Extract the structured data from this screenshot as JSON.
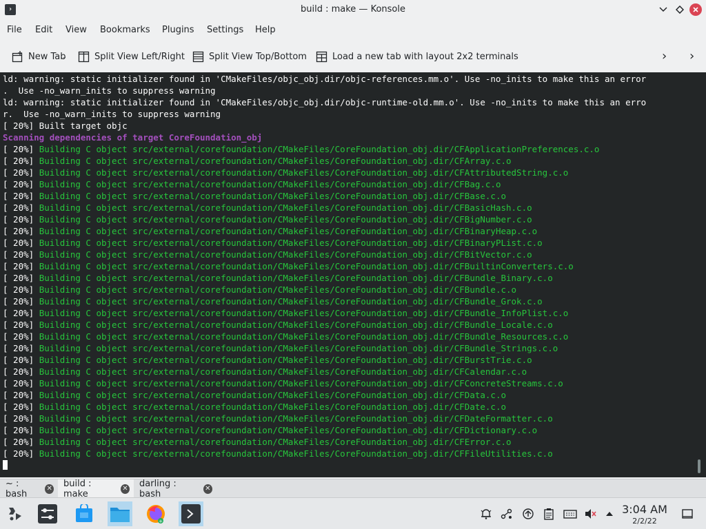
{
  "window": {
    "title": "build : make — Konsole",
    "app_icon_glyph": "›"
  },
  "menu": {
    "items": [
      "File",
      "Edit",
      "View",
      "Bookmarks",
      "Plugins",
      "Settings",
      "Help"
    ]
  },
  "toolbar": {
    "new_tab": "New Tab",
    "split_lr": "Split View Left/Right",
    "split_tb": "Split View Top/Bottom",
    "layout_2x2": "Load a new tab with layout 2x2 terminals"
  },
  "terminal": {
    "background": "#232627",
    "lines": [
      {
        "pre": "",
        "text": "ld: warning: static initializer found in 'CMakeFiles/objc_obj.dir/objc-references.mm.o'. Use -no_inits to make this an error",
        "style": "plain"
      },
      {
        "pre": "",
        "text": ".  Use -no_warn_inits to suppress warning",
        "style": "plain"
      },
      {
        "pre": "",
        "text": "ld: warning: static initializer found in 'CMakeFiles/objc_obj.dir/objc-runtime-old.mm.o'. Use -no_inits to make this an erro",
        "style": "plain"
      },
      {
        "pre": "",
        "text": "r.  Use -no_warn_inits to suppress warning",
        "style": "plain"
      },
      {
        "pre": "",
        "text": "[ 20%] Built target objc",
        "style": "plain"
      },
      {
        "pre": "",
        "text": "Scanning dependencies of target CoreFoundation_obj",
        "style": "purple"
      },
      {
        "pre": "[ 20%] ",
        "text": "Building C object src/external/corefoundation/CMakeFiles/CoreFoundation_obj.dir/CFApplicationPreferences.c.o",
        "style": "green"
      },
      {
        "pre": "[ 20%] ",
        "text": "Building C object src/external/corefoundation/CMakeFiles/CoreFoundation_obj.dir/CFArray.c.o",
        "style": "green"
      },
      {
        "pre": "[ 20%] ",
        "text": "Building C object src/external/corefoundation/CMakeFiles/CoreFoundation_obj.dir/CFAttributedString.c.o",
        "style": "green"
      },
      {
        "pre": "[ 20%] ",
        "text": "Building C object src/external/corefoundation/CMakeFiles/CoreFoundation_obj.dir/CFBag.c.o",
        "style": "green"
      },
      {
        "pre": "[ 20%] ",
        "text": "Building C object src/external/corefoundation/CMakeFiles/CoreFoundation_obj.dir/CFBase.c.o",
        "style": "green"
      },
      {
        "pre": "[ 20%] ",
        "text": "Building C object src/external/corefoundation/CMakeFiles/CoreFoundation_obj.dir/CFBasicHash.c.o",
        "style": "green"
      },
      {
        "pre": "[ 20%] ",
        "text": "Building C object src/external/corefoundation/CMakeFiles/CoreFoundation_obj.dir/CFBigNumber.c.o",
        "style": "green"
      },
      {
        "pre": "[ 20%] ",
        "text": "Building C object src/external/corefoundation/CMakeFiles/CoreFoundation_obj.dir/CFBinaryHeap.c.o",
        "style": "green"
      },
      {
        "pre": "[ 20%] ",
        "text": "Building C object src/external/corefoundation/CMakeFiles/CoreFoundation_obj.dir/CFBinaryPList.c.o",
        "style": "green"
      },
      {
        "pre": "[ 20%] ",
        "text": "Building C object src/external/corefoundation/CMakeFiles/CoreFoundation_obj.dir/CFBitVector.c.o",
        "style": "green"
      },
      {
        "pre": "[ 20%] ",
        "text": "Building C object src/external/corefoundation/CMakeFiles/CoreFoundation_obj.dir/CFBuiltinConverters.c.o",
        "style": "green"
      },
      {
        "pre": "[ 20%] ",
        "text": "Building C object src/external/corefoundation/CMakeFiles/CoreFoundation_obj.dir/CFBundle_Binary.c.o",
        "style": "green"
      },
      {
        "pre": "[ 20%] ",
        "text": "Building C object src/external/corefoundation/CMakeFiles/CoreFoundation_obj.dir/CFBundle.c.o",
        "style": "green"
      },
      {
        "pre": "[ 20%] ",
        "text": "Building C object src/external/corefoundation/CMakeFiles/CoreFoundation_obj.dir/CFBundle_Grok.c.o",
        "style": "green"
      },
      {
        "pre": "[ 20%] ",
        "text": "Building C object src/external/corefoundation/CMakeFiles/CoreFoundation_obj.dir/CFBundle_InfoPlist.c.o",
        "style": "green"
      },
      {
        "pre": "[ 20%] ",
        "text": "Building C object src/external/corefoundation/CMakeFiles/CoreFoundation_obj.dir/CFBundle_Locale.c.o",
        "style": "green"
      },
      {
        "pre": "[ 20%] ",
        "text": "Building C object src/external/corefoundation/CMakeFiles/CoreFoundation_obj.dir/CFBundle_Resources.c.o",
        "style": "green"
      },
      {
        "pre": "[ 20%] ",
        "text": "Building C object src/external/corefoundation/CMakeFiles/CoreFoundation_obj.dir/CFBundle_Strings.c.o",
        "style": "green"
      },
      {
        "pre": "[ 20%] ",
        "text": "Building C object src/external/corefoundation/CMakeFiles/CoreFoundation_obj.dir/CFBurstTrie.c.o",
        "style": "green"
      },
      {
        "pre": "[ 20%] ",
        "text": "Building C object src/external/corefoundation/CMakeFiles/CoreFoundation_obj.dir/CFCalendar.c.o",
        "style": "green"
      },
      {
        "pre": "[ 20%] ",
        "text": "Building C object src/external/corefoundation/CMakeFiles/CoreFoundation_obj.dir/CFConcreteStreams.c.o",
        "style": "green"
      },
      {
        "pre": "[ 20%] ",
        "text": "Building C object src/external/corefoundation/CMakeFiles/CoreFoundation_obj.dir/CFData.c.o",
        "style": "green"
      },
      {
        "pre": "[ 20%] ",
        "text": "Building C object src/external/corefoundation/CMakeFiles/CoreFoundation_obj.dir/CFDate.c.o",
        "style": "green"
      },
      {
        "pre": "[ 20%] ",
        "text": "Building C object src/external/corefoundation/CMakeFiles/CoreFoundation_obj.dir/CFDateFormatter.c.o",
        "style": "green"
      },
      {
        "pre": "[ 20%] ",
        "text": "Building C object src/external/corefoundation/CMakeFiles/CoreFoundation_obj.dir/CFDictionary.c.o",
        "style": "green"
      },
      {
        "pre": "[ 20%] ",
        "text": "Building C object src/external/corefoundation/CMakeFiles/CoreFoundation_obj.dir/CFError.c.o",
        "style": "green"
      },
      {
        "pre": "[ 20%] ",
        "text": "Building C object src/external/corefoundation/CMakeFiles/CoreFoundation_obj.dir/CFFileUtilities.c.o",
        "style": "green"
      }
    ]
  },
  "tabs": [
    {
      "label": "~ : bash",
      "active": false
    },
    {
      "label": "build : make",
      "active": true
    },
    {
      "label": "darling : bash",
      "active": false
    }
  ],
  "taskbar": {
    "apps": [
      "application-launcher-icon",
      "system-settings-icon",
      "discover-store-icon",
      "dolphin-file-manager-icon",
      "firefox-icon",
      "konsole-icon"
    ],
    "tray": [
      "notifications-icon",
      "network-icon",
      "updates-icon",
      "clipboard-icon",
      "keyboard-icon",
      "volume-muted-icon",
      "tray-expand-icon"
    ],
    "clock_time": "3:04 AM",
    "clock_date": "2/2/22"
  }
}
